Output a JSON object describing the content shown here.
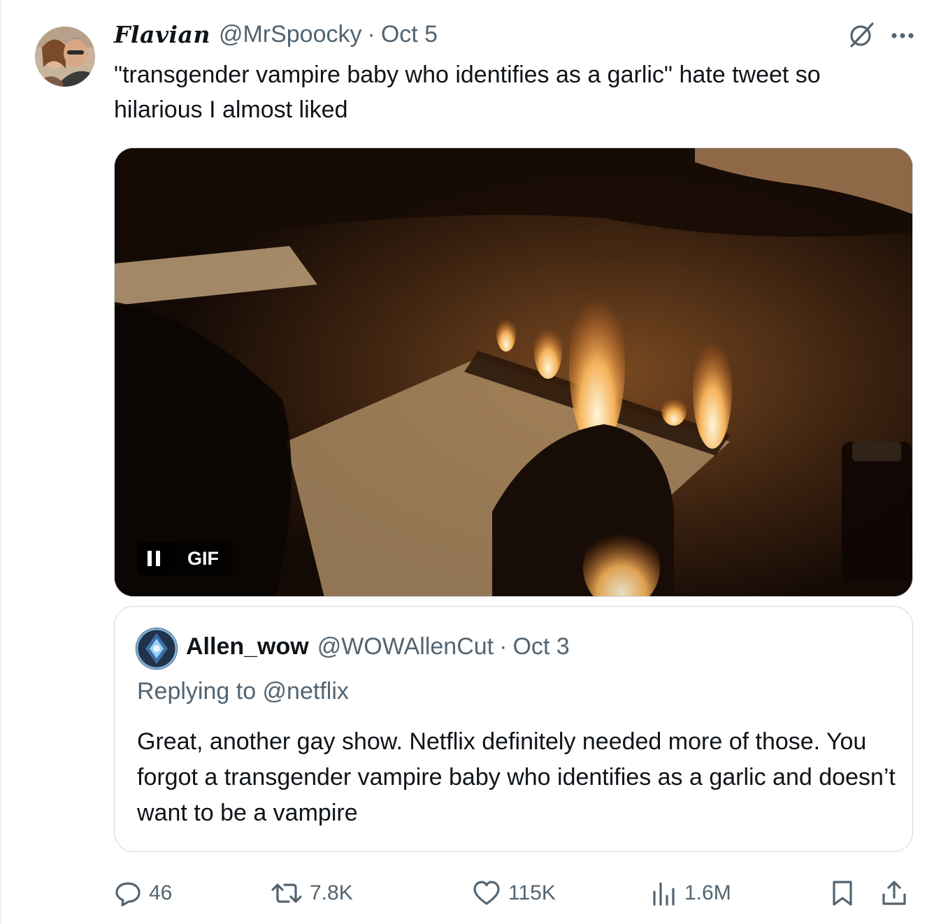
{
  "tweet": {
    "display_name": "Flavian",
    "handle": "@MrSpoocky",
    "separator": "·",
    "date": "Oct 5",
    "text": "\"transgender vampire baby who identifies as a garlic\" hate tweet so hilarious I almost liked",
    "icons": {
      "grok": "grok-slash-icon",
      "more": "more-dots-icon"
    }
  },
  "media": {
    "badge": "GIF",
    "pause_icon": "pause-icon"
  },
  "quote": {
    "display_name": "Allen_wow",
    "handle": "@WOWAllenCut",
    "separator": "·",
    "date": "Oct 3",
    "replying_prefix": "Replying to ",
    "replying_to": "@netflix",
    "text": "Great, another gay show. Netflix definitely needed more of those. You forgot a transgender vampire baby who identifies as a garlic and doesn’t want to be a vampire"
  },
  "actions": {
    "replies": "46",
    "retweets": "7.8K",
    "likes": "115K",
    "views": "1.6M"
  },
  "colors": {
    "text_primary": "#0f1419",
    "text_secondary": "#536471",
    "border": "#cfd9de",
    "background": "#ffffff"
  }
}
